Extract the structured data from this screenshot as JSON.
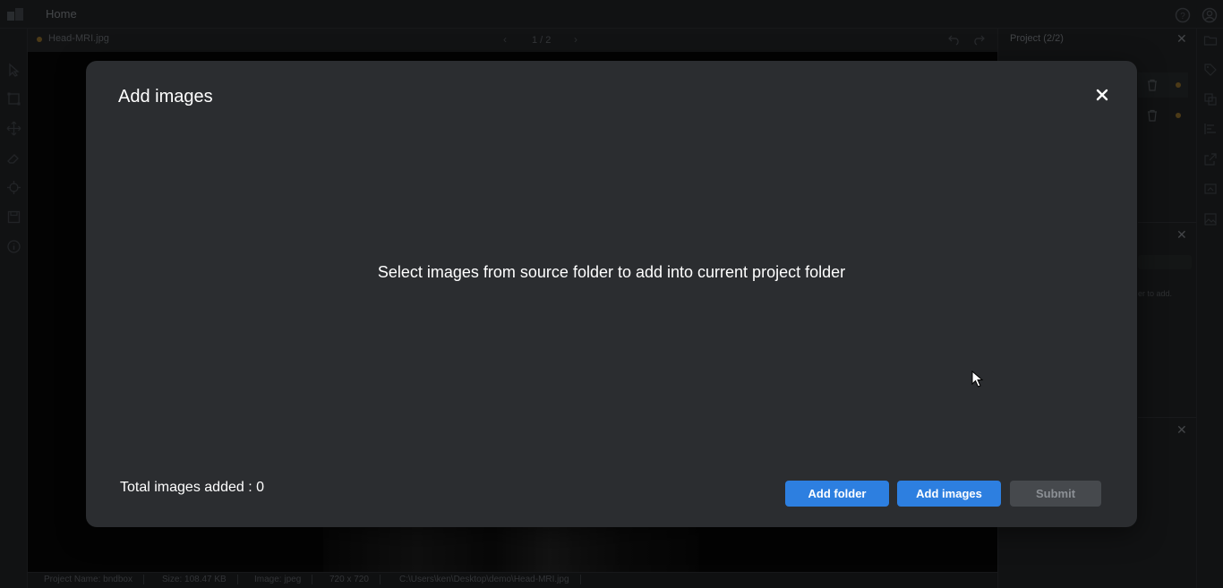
{
  "app": {
    "home_label": "Home"
  },
  "tab": {
    "filename": "Head-MRI.jpg",
    "pager": "1 / 2"
  },
  "statusbar": {
    "project_name": "Project Name: bndbox",
    "size": "Size: 108.47 KB",
    "image_type": "Image: jpeg",
    "dimensions": "720 x 720",
    "path": "C:\\Users\\ken\\Desktop\\demo\\Head-MRI.jpg"
  },
  "right_panel": {
    "title": "Project (2/2)",
    "hint": "er to add."
  },
  "modal": {
    "title": "Add images",
    "message": "Select images from source folder to add into current project folder",
    "total_label": "Total images added : 0",
    "buttons": {
      "add_folder": "Add folder",
      "add_images": "Add images",
      "submit": "Submit"
    }
  },
  "colors": {
    "primary": "#2d7fe0",
    "modal_bg": "#2b2d30",
    "disabled": "#46494d",
    "dot": "#8a6a2a"
  }
}
